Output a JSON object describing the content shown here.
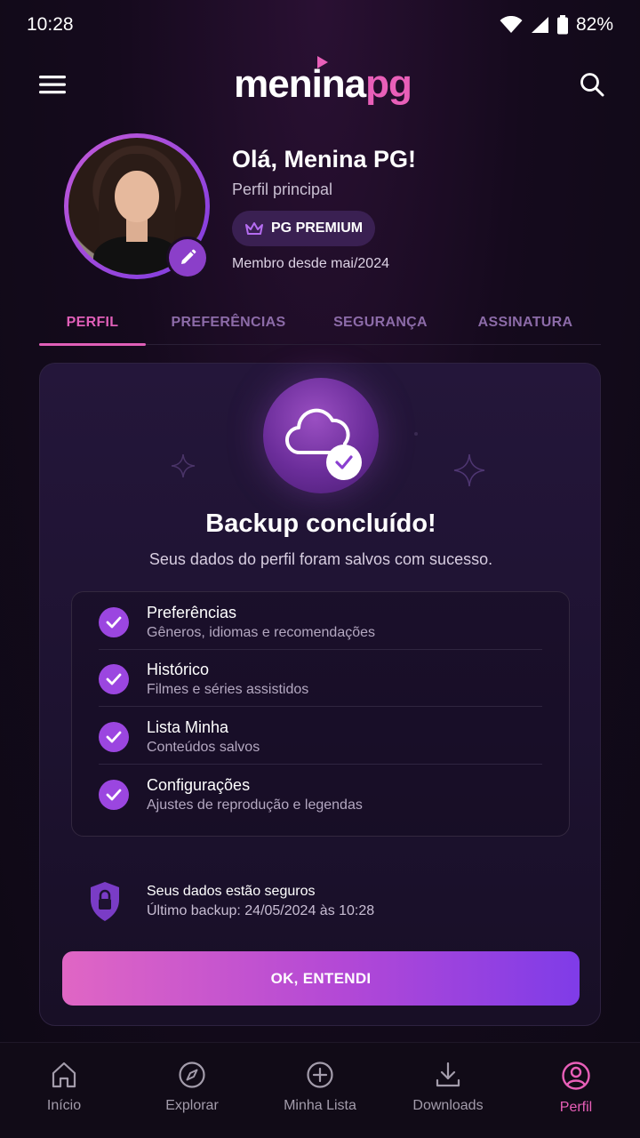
{
  "status_bar": {
    "time": "10:28",
    "battery": "82%"
  },
  "header": {
    "logo_part1": "menina",
    "logo_part2": "pg",
    "menu_icon": "menu-icon",
    "search_icon": "search-icon"
  },
  "profile": {
    "greeting": "Olá, Menina PG!",
    "subtitle": "Perfil principal",
    "badge": "PG PREMIUM",
    "member_since": "Membro desde mai/2024"
  },
  "tabs": [
    {
      "label": "PERFIL",
      "active": true
    },
    {
      "label": "PREFERÊNCIAS",
      "active": false
    },
    {
      "label": "SEGURANÇA",
      "active": false
    },
    {
      "label": "ASSINATURA",
      "active": false
    }
  ],
  "card": {
    "title": "Backup concluído!",
    "subtitle": "Seus dados do perfil foram salvos com sucesso.",
    "items": [
      {
        "title": "Preferências",
        "desc": "Gêneros, idiomas e recomendações"
      },
      {
        "title": "Histórico",
        "desc": "Filmes e séries assistidos"
      },
      {
        "title": "Lista Minha",
        "desc": "Conteúdos salvos"
      },
      {
        "title": "Configurações",
        "desc": "Ajustes de reprodução e legendas"
      }
    ],
    "secure_title": "Seus dados estão seguros",
    "secure_sub": "Último backup: 24/05/2024 às 10:28",
    "button": "OK, ENTENDI"
  },
  "nav": [
    {
      "label": "Início",
      "icon": "home-icon",
      "active": false
    },
    {
      "label": "Explorar",
      "icon": "compass-icon",
      "active": false
    },
    {
      "label": "Minha Lista",
      "icon": "plus-circle-icon",
      "active": false
    },
    {
      "label": "Downloads",
      "icon": "download-icon",
      "active": false
    },
    {
      "label": "Perfil",
      "icon": "profile-icon",
      "active": true
    }
  ],
  "colors": {
    "accent_pink": "#e05fb8",
    "accent_purple": "#9b46e0",
    "tab_inactive": "#8c6ba8"
  }
}
